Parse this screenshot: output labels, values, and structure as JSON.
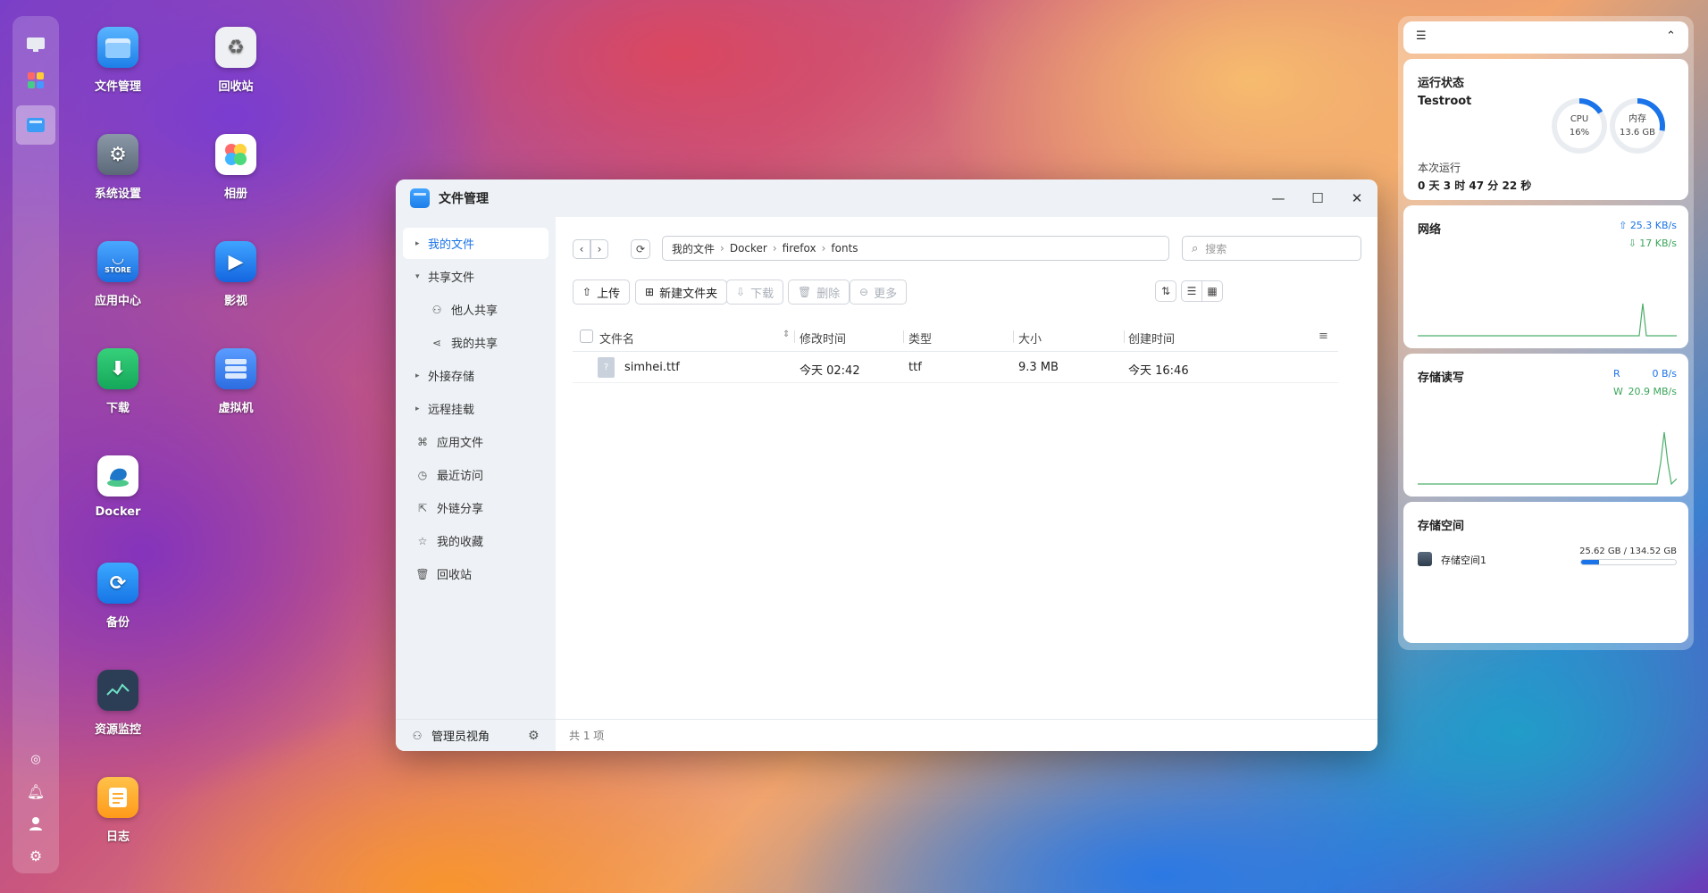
{
  "desktop": {
    "icons": [
      {
        "label": "文件管理",
        "icon": "file-manager-icon"
      },
      {
        "label": "回收站",
        "icon": "recycle-bin-icon"
      },
      {
        "label": "系统设置",
        "icon": "gear-icon"
      },
      {
        "label": "相册",
        "icon": "photos-icon"
      },
      {
        "label": "应用中心",
        "icon": "store-icon",
        "badge": "STORE"
      },
      {
        "label": "影视",
        "icon": "video-icon"
      },
      {
        "label": "下载",
        "icon": "download-icon"
      },
      {
        "label": "虚拟机",
        "icon": "vm-icon"
      },
      {
        "label": "Docker",
        "icon": "docker-icon"
      },
      {
        "label": "备份",
        "icon": "backup-icon"
      },
      {
        "label": "资源监控",
        "icon": "monitor-icon"
      },
      {
        "label": "日志",
        "icon": "log-icon"
      }
    ]
  },
  "window": {
    "title": "文件管理",
    "controls": {
      "minimize": "—",
      "maximize": "☐",
      "close": "✕"
    },
    "sidebar": {
      "items": [
        {
          "label": "我的文件",
          "caret": "▸"
        },
        {
          "label": "共享文件",
          "caret": "▾"
        },
        {
          "label": "他人共享"
        },
        {
          "label": "我的共享"
        },
        {
          "label": "外接存储",
          "caret": "▸"
        },
        {
          "label": "远程挂载",
          "caret": "▸"
        },
        {
          "label": "应用文件"
        },
        {
          "label": "最近访问"
        },
        {
          "label": "外链分享"
        },
        {
          "label": "我的收藏"
        },
        {
          "label": "回收站"
        }
      ],
      "footer": "管理员视角"
    },
    "path": [
      "我的文件",
      "Docker",
      "firefox",
      "fonts"
    ],
    "search_placeholder": "搜索",
    "toolbar": {
      "upload": "上传",
      "new_folder": "新建文件夹",
      "download": "下载",
      "delete": "删除",
      "more": "更多"
    },
    "table": {
      "columns": [
        "文件名",
        "修改时间",
        "类型",
        "大小",
        "创建时间"
      ],
      "rows": [
        {
          "name": "simhei.ttf",
          "modified": "今天 02:42",
          "type": "ttf",
          "size": "9.3 MB",
          "created": "今天 16:46"
        }
      ]
    },
    "status": "共 1 项"
  },
  "widgets": {
    "run_status": {
      "title": "运行状态",
      "host": "Testroot",
      "cpu_label": "CPU",
      "cpu_value": "16%",
      "cpu_fraction": 0.16,
      "mem_label": "内存",
      "mem_value": "13.6 GB",
      "mem_fraction": 0.28,
      "uptime_label": "本次运行",
      "uptime": "0 天 3 时 47 分 22 秒"
    },
    "network": {
      "title": "网络",
      "up": "25.3 KB/s",
      "down": "17 KB/s"
    },
    "disk_io": {
      "title": "存储读写",
      "read_label": "R",
      "read": "0 B/s",
      "write_label": "W",
      "write": "20.9 MB/s"
    },
    "storage": {
      "title": "存储空间",
      "name": "存储空间1",
      "usage": "25.62 GB / 134.52 GB",
      "fraction": 0.19
    },
    "accent": "#1a73e8",
    "chart_green": "#4caf6a"
  }
}
